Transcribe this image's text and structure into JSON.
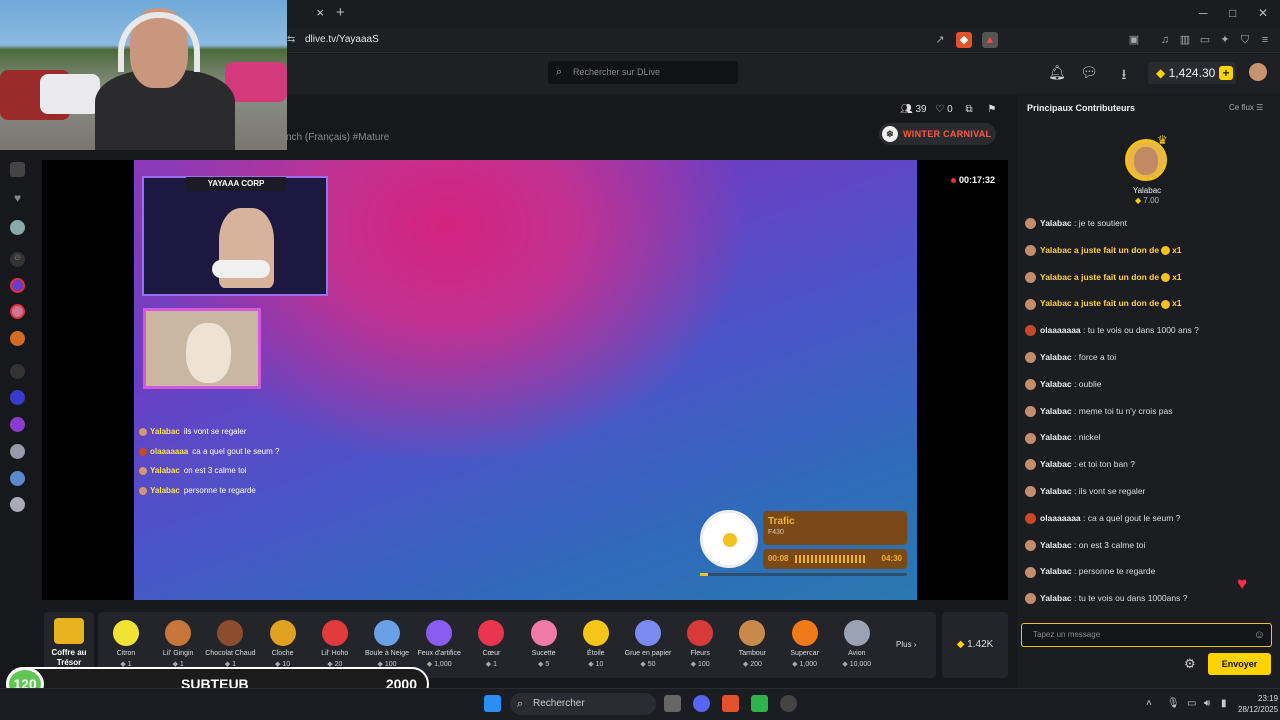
{
  "browser": {
    "url": "dlive.tv/YayaaaS",
    "tab_close": "×",
    "new_tab": "+",
    "min": "─",
    "max": "□",
    "close": "✕"
  },
  "header": {
    "search_placeholder": "Rechercher sur DLive",
    "balance": "1,424.30",
    "plus": "+"
  },
  "stream": {
    "tags": "nch (Français)  #Mature",
    "viewers": "39",
    "likes": "0",
    "event": "WINTER CARNIVAL",
    "timer": "00:17:32",
    "overlay_cam_label": "YAYAAA CORP",
    "overlay_chat": [
      {
        "name": "Yalabac",
        "text": "ils vont se regaler"
      },
      {
        "name": "olaaaaaaa",
        "text": "ca a quel gout le seum ?"
      },
      {
        "name": "Yalabac",
        "text": "on est 3 calme toi"
      },
      {
        "name": "Yalabac",
        "text": "personne te regarde"
      }
    ],
    "music": {
      "title": "Trafic",
      "artist": "F430",
      "current": "00:08",
      "total": "04:30"
    }
  },
  "gifts": {
    "chest": "Coffre au Trésor",
    "items": [
      {
        "name": "Citron",
        "price": "1",
        "color": "#f2e233"
      },
      {
        "name": "Lil' Gingin",
        "price": "1",
        "color": "#c6763a"
      },
      {
        "name": "Chocolat Chaud",
        "price": "1",
        "color": "#8b4d2e"
      },
      {
        "name": "Cloche",
        "price": "10",
        "color": "#e0a020"
      },
      {
        "name": "Lil' Hoho",
        "price": "20",
        "color": "#e23b3b"
      },
      {
        "name": "Boule à Neige",
        "price": "100",
        "color": "#6aa0e6"
      },
      {
        "name": "Feux d'artifice",
        "price": "1,000",
        "color": "#8a5cf0"
      },
      {
        "name": "Cœur",
        "price": "1",
        "color": "#e8364e"
      },
      {
        "name": "Sucette",
        "price": "5",
        "color": "#f07aa8"
      },
      {
        "name": "Étoile",
        "price": "10",
        "color": "#f5c518"
      },
      {
        "name": "Grue en papier",
        "price": "50",
        "color": "#7a8cf0"
      },
      {
        "name": "Fleurs",
        "price": "100",
        "color": "#d83a3a"
      },
      {
        "name": "Tambour",
        "price": "200",
        "color": "#c9894a"
      },
      {
        "name": "Supercar",
        "price": "1,000",
        "color": "#f07a18"
      },
      {
        "name": "Avion",
        "price": "10,000",
        "color": "#9aa2b4"
      }
    ],
    "more": "Plus ›",
    "diamonds": "1.42K"
  },
  "sub_overlay": {
    "count": "120",
    "label": "SUBTEUB",
    "goal": "2000"
  },
  "chat": {
    "title": "Principaux Contributeurs",
    "flux": "Ce flux",
    "top_name": "Yalabac",
    "top_amount": "7.00",
    "messages": [
      {
        "name": "Yalabac",
        "text": "je te soutient",
        "type": "normal"
      },
      {
        "name": "Yalabac",
        "text": "a juste fait un don de",
        "type": "gift",
        "qty": "x1"
      },
      {
        "name": "Yalabac",
        "text": "a juste fait un don de",
        "type": "gift",
        "qty": "x1"
      },
      {
        "name": "Yalabac",
        "text": "a juste fait un don de",
        "type": "gift",
        "qty": "x1"
      },
      {
        "name": "olaaaaaaa",
        "text": "tu te vois ou dans 1000 ans ?",
        "type": "normal"
      },
      {
        "name": "Yalabac",
        "text": "force a toi",
        "type": "normal"
      },
      {
        "name": "Yalabac",
        "text": "oublie",
        "type": "normal"
      },
      {
        "name": "Yalabac",
        "text": "meme toi tu n'y crois pas",
        "type": "normal"
      },
      {
        "name": "Yalabac",
        "text": "nickel",
        "type": "normal"
      },
      {
        "name": "Yalabac",
        "text": "et toi ton ban ?",
        "type": "normal"
      },
      {
        "name": "Yalabac",
        "text": "ils vont se regaler",
        "type": "normal"
      },
      {
        "name": "olaaaaaaa",
        "text": "ca a quel gout le seum ?",
        "type": "normal"
      },
      {
        "name": "Yalabac",
        "text": "on est 3 calme toi",
        "type": "normal"
      },
      {
        "name": "Yalabac",
        "text": "personne te regarde",
        "type": "normal"
      },
      {
        "name": "Yalabac",
        "text": "tu te vois ou dans 1000ans ?",
        "type": "normal"
      }
    ],
    "input_placeholder": "Tapez un message",
    "send": "Envoyer"
  },
  "taskbar": {
    "search": "Rechercher",
    "time": "23:19",
    "date": "28/12/2025"
  },
  "accent": "#ffd300"
}
